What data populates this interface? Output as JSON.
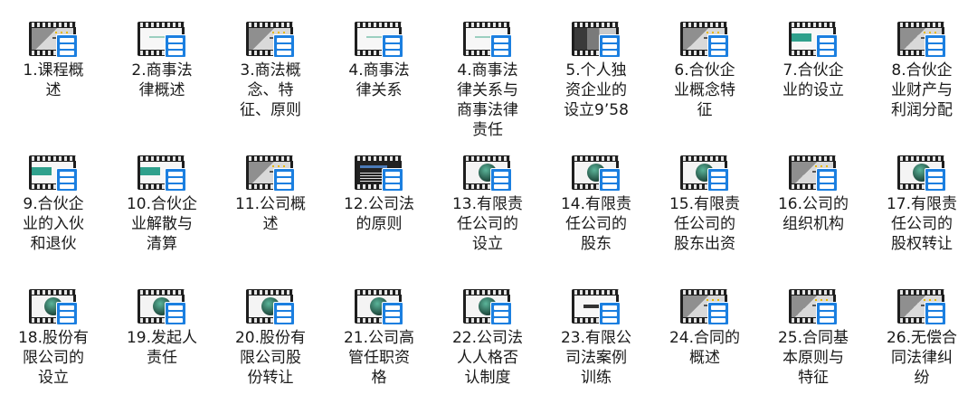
{
  "items": [
    {
      "label": "1.课程概述",
      "thumb": "building"
    },
    {
      "label": "2.商事法律概述",
      "thumb": "white"
    },
    {
      "label": "3.商法概念、特征、原则",
      "thumb": "building"
    },
    {
      "label": "4.商事法律关系",
      "thumb": "white"
    },
    {
      "label": "4.商事法律关系与商事法律责任",
      "thumb": "white"
    },
    {
      "label": "5.个人独资企业的设立9’58",
      "thumb": "photo"
    },
    {
      "label": "6.合伙企业概念特征",
      "thumb": "building"
    },
    {
      "label": "7.合伙企业的设立",
      "thumb": "part"
    },
    {
      "label": "8.合伙企业财产与利润分配",
      "thumb": "building"
    },
    {
      "label": "9.合伙企业的入伙和退伙",
      "thumb": "part"
    },
    {
      "label": "10.合伙企业解散与清算",
      "thumb": "part"
    },
    {
      "label": "11.公司概述",
      "thumb": "building"
    },
    {
      "label": "12.公司法的原则",
      "thumb": "dark"
    },
    {
      "label": "13.有限责任公司的设立",
      "thumb": "globe"
    },
    {
      "label": "14.有限责任公司的股东",
      "thumb": "globe"
    },
    {
      "label": "15.有限责任公司的股东出资",
      "thumb": "globe"
    },
    {
      "label": "16.公司的组织机构",
      "thumb": "building"
    },
    {
      "label": "17.有限责任公司的股权转让",
      "thumb": "globe"
    },
    {
      "label": "18.股份有限公司的设立",
      "thumb": "globe"
    },
    {
      "label": "19.发起人责任",
      "thumb": "globe"
    },
    {
      "label": "20.股份有限公司股份转让",
      "thumb": "globe"
    },
    {
      "label": "21.公司高管任职资格",
      "thumb": "globe"
    },
    {
      "label": "22.公司法人人格否认制度",
      "thumb": "globe"
    },
    {
      "label": "23.有限公司法案例训练",
      "thumb": "text"
    },
    {
      "label": "24.合同的概述",
      "thumb": "building"
    },
    {
      "label": "25.合同基本原则与特征",
      "thumb": "building"
    },
    {
      "label": "26.无偿合同法律纠纷",
      "thumb": "building"
    }
  ]
}
